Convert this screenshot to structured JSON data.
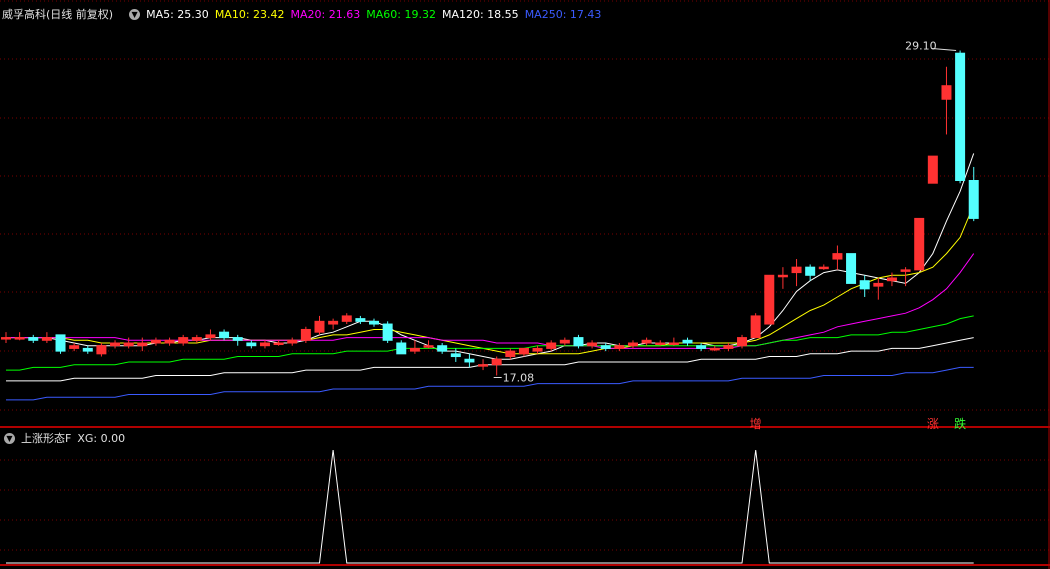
{
  "main_header": {
    "stock_name": "威孚高科",
    "period": "(日线 前复权)",
    "ma": [
      {
        "label": "MA5: 25.30",
        "color": "#ffffff"
      },
      {
        "label": "MA10: 23.42",
        "color": "#ffff00"
      },
      {
        "label": "MA20: 21.63",
        "color": "#ff00ff"
      },
      {
        "label": "MA60: 19.32",
        "color": "#00ff00"
      },
      {
        "label": "MA120: 18.55",
        "color": "#ffffff"
      },
      {
        "label": "MA250: 17.43",
        "color": "#3b5bff"
      }
    ]
  },
  "annotations": {
    "high": "29.10",
    "low": "17.08"
  },
  "signals": {
    "zeng": "增",
    "zhang": "涨",
    "die": "跌"
  },
  "sub_header": {
    "indicator": "上涨形态F",
    "xg": "XG: 0.00"
  },
  "colors": {
    "up": "#ff3232",
    "down": "#54ffff",
    "grid": "#7a0000",
    "border": "#b00000"
  },
  "chart_data": {
    "type": "candlestick",
    "price_range": [
      15.9,
      30.3
    ],
    "candles": [
      [
        18.5,
        18.7,
        18.3,
        18.5
      ],
      [
        18.5,
        18.7,
        18.4,
        18.5
      ],
      [
        18.5,
        18.6,
        18.3,
        18.4
      ],
      [
        18.4,
        18.7,
        18.3,
        18.5
      ],
      [
        18.6,
        18.6,
        17.9,
        18.0
      ],
      [
        18.1,
        18.3,
        18.0,
        18.2
      ],
      [
        18.1,
        18.2,
        17.9,
        18.0
      ],
      [
        17.9,
        18.3,
        17.8,
        18.2
      ],
      [
        18.2,
        18.4,
        18.1,
        18.3
      ],
      [
        18.2,
        18.5,
        18.1,
        18.3
      ],
      [
        18.2,
        18.5,
        18.0,
        18.3
      ],
      [
        18.3,
        18.5,
        18.2,
        18.4
      ],
      [
        18.3,
        18.5,
        18.2,
        18.4
      ],
      [
        18.3,
        18.6,
        18.2,
        18.5
      ],
      [
        18.4,
        18.6,
        18.3,
        18.5
      ],
      [
        18.5,
        18.8,
        18.4,
        18.6
      ],
      [
        18.7,
        18.8,
        18.4,
        18.5
      ],
      [
        18.5,
        18.6,
        18.2,
        18.4
      ],
      [
        18.3,
        18.4,
        18.1,
        18.2
      ],
      [
        18.2,
        18.4,
        18.1,
        18.3
      ],
      [
        18.3,
        18.4,
        18.2,
        18.3
      ],
      [
        18.3,
        18.5,
        18.2,
        18.4
      ],
      [
        18.4,
        18.9,
        18.3,
        18.8
      ],
      [
        18.7,
        19.3,
        18.6,
        19.1
      ],
      [
        19.0,
        19.2,
        18.8,
        19.1
      ],
      [
        19.1,
        19.4,
        19.0,
        19.3
      ],
      [
        19.2,
        19.3,
        19.0,
        19.1
      ],
      [
        19.1,
        19.2,
        18.9,
        19.0
      ],
      [
        19.0,
        19.1,
        18.3,
        18.4
      ],
      [
        18.3,
        18.4,
        17.9,
        17.9
      ],
      [
        18.0,
        18.4,
        17.9,
        18.1
      ],
      [
        18.2,
        18.4,
        18.1,
        18.2
      ],
      [
        18.2,
        18.3,
        17.9,
        18.0
      ],
      [
        17.9,
        18.1,
        17.6,
        17.8
      ],
      [
        17.7,
        17.9,
        17.4,
        17.6
      ],
      [
        17.5,
        17.7,
        17.3,
        17.5
      ],
      [
        17.5,
        17.8,
        17.1,
        17.7
      ],
      [
        17.8,
        18.1,
        17.7,
        18.0
      ],
      [
        17.9,
        18.1,
        17.8,
        18.1
      ],
      [
        18.0,
        18.2,
        17.9,
        18.1
      ],
      [
        18.1,
        18.4,
        18.0,
        18.3
      ],
      [
        18.3,
        18.5,
        18.2,
        18.4
      ],
      [
        18.5,
        18.6,
        18.1,
        18.2
      ],
      [
        18.2,
        18.4,
        18.1,
        18.3
      ],
      [
        18.2,
        18.3,
        18.0,
        18.1
      ],
      [
        18.1,
        18.3,
        18.0,
        18.2
      ],
      [
        18.2,
        18.4,
        18.1,
        18.3
      ],
      [
        18.3,
        18.5,
        18.2,
        18.4
      ],
      [
        18.3,
        18.4,
        18.2,
        18.3
      ],
      [
        18.3,
        18.5,
        18.2,
        18.3
      ],
      [
        18.4,
        18.5,
        18.2,
        18.3
      ],
      [
        18.2,
        18.3,
        18.0,
        18.1
      ],
      [
        18.1,
        18.2,
        18.0,
        18.1
      ],
      [
        18.1,
        18.3,
        18.0,
        18.2
      ],
      [
        18.2,
        18.6,
        18.1,
        18.5
      ],
      [
        18.5,
        19.4,
        18.5,
        19.3
      ],
      [
        19.0,
        20.8,
        19.0,
        20.8
      ],
      [
        20.8,
        21.1,
        20.3,
        20.8
      ],
      [
        20.9,
        21.4,
        20.4,
        21.1
      ],
      [
        21.1,
        21.2,
        20.6,
        20.8
      ],
      [
        21.1,
        21.2,
        21.0,
        21.1
      ],
      [
        21.4,
        21.9,
        21.0,
        21.6
      ],
      [
        21.6,
        21.6,
        20.5,
        20.5
      ],
      [
        20.6,
        20.8,
        20.0,
        20.3
      ],
      [
        20.4,
        20.7,
        19.9,
        20.5
      ],
      [
        20.6,
        20.9,
        20.4,
        20.7
      ],
      [
        21.0,
        21.1,
        20.4,
        21.0
      ],
      [
        21.0,
        22.9,
        21.0,
        22.9
      ],
      [
        24.2,
        25.2,
        24.2,
        25.2
      ],
      [
        27.3,
        28.5,
        26.0,
        27.8
      ],
      [
        29.0,
        29.1,
        24.2,
        24.3
      ],
      [
        24.3,
        24.8,
        22.8,
        22.9
      ]
    ],
    "ma_series": [
      {
        "name": "MA5",
        "color": "#ffffff",
        "values": [
          18.5,
          18.5,
          18.5,
          18.5,
          18.4,
          18.3,
          18.2,
          18.2,
          18.2,
          18.2,
          18.2,
          18.3,
          18.3,
          18.4,
          18.4,
          18.5,
          18.5,
          18.5,
          18.4,
          18.4,
          18.3,
          18.3,
          18.4,
          18.6,
          18.7,
          18.9,
          19.1,
          19.1,
          18.9,
          18.6,
          18.4,
          18.2,
          18.0,
          18.0,
          17.9,
          17.8,
          17.7,
          17.7,
          17.8,
          17.9,
          18.0,
          18.2,
          18.2,
          18.3,
          18.3,
          18.2,
          18.2,
          18.3,
          18.3,
          18.3,
          18.3,
          18.3,
          18.2,
          18.2,
          18.3,
          18.5,
          18.9,
          19.5,
          20.2,
          20.6,
          20.9,
          21.0,
          20.9,
          20.8,
          20.7,
          20.6,
          20.5,
          20.9,
          21.6,
          22.8,
          23.9,
          25.3
        ]
      },
      {
        "name": "MA10",
        "color": "#ffff00",
        "values": [
          18.5,
          18.5,
          18.5,
          18.5,
          18.5,
          18.4,
          18.4,
          18.3,
          18.3,
          18.3,
          18.3,
          18.3,
          18.3,
          18.3,
          18.3,
          18.4,
          18.4,
          18.4,
          18.4,
          18.4,
          18.4,
          18.4,
          18.4,
          18.5,
          18.6,
          18.6,
          18.7,
          18.8,
          18.8,
          18.7,
          18.6,
          18.5,
          18.4,
          18.3,
          18.2,
          18.1,
          18.0,
          17.9,
          17.9,
          17.9,
          17.9,
          17.9,
          17.9,
          18.0,
          18.1,
          18.1,
          18.2,
          18.2,
          18.2,
          18.3,
          18.3,
          18.3,
          18.3,
          18.3,
          18.3,
          18.4,
          18.6,
          18.9,
          19.2,
          19.5,
          19.7,
          20.0,
          20.3,
          20.5,
          20.7,
          20.8,
          20.8,
          20.9,
          21.1,
          21.6,
          22.2,
          23.4
        ]
      },
      {
        "name": "MA20",
        "color": "#ff00ff",
        "values": [
          18.5,
          18.5,
          18.5,
          18.5,
          18.5,
          18.5,
          18.5,
          18.5,
          18.5,
          18.4,
          18.4,
          18.4,
          18.4,
          18.4,
          18.4,
          18.4,
          18.4,
          18.4,
          18.4,
          18.4,
          18.4,
          18.4,
          18.4,
          18.4,
          18.4,
          18.5,
          18.5,
          18.5,
          18.5,
          18.5,
          18.5,
          18.5,
          18.4,
          18.4,
          18.4,
          18.4,
          18.3,
          18.3,
          18.3,
          18.3,
          18.2,
          18.2,
          18.2,
          18.2,
          18.1,
          18.1,
          18.1,
          18.1,
          18.1,
          18.1,
          18.1,
          18.1,
          18.1,
          18.1,
          18.2,
          18.2,
          18.3,
          18.4,
          18.5,
          18.6,
          18.7,
          18.9,
          19.0,
          19.1,
          19.2,
          19.3,
          19.4,
          19.6,
          19.9,
          20.3,
          20.9,
          21.6
        ]
      },
      {
        "name": "MA60",
        "color": "#00ff00",
        "values": [
          17.3,
          17.3,
          17.4,
          17.4,
          17.4,
          17.5,
          17.5,
          17.5,
          17.5,
          17.6,
          17.6,
          17.6,
          17.6,
          17.7,
          17.7,
          17.7,
          17.7,
          17.8,
          17.8,
          17.8,
          17.8,
          17.9,
          17.9,
          17.9,
          17.9,
          18.0,
          18.0,
          18.0,
          18.0,
          18.1,
          18.1,
          18.1,
          18.1,
          18.1,
          18.1,
          18.1,
          18.1,
          18.1,
          18.1,
          18.2,
          18.2,
          18.2,
          18.2,
          18.2,
          18.2,
          18.2,
          18.2,
          18.2,
          18.2,
          18.2,
          18.2,
          18.2,
          18.2,
          18.2,
          18.2,
          18.2,
          18.3,
          18.4,
          18.4,
          18.5,
          18.5,
          18.5,
          18.6,
          18.6,
          18.6,
          18.7,
          18.7,
          18.8,
          18.9,
          19.0,
          19.2,
          19.3
        ]
      },
      {
        "name": "MA120",
        "color": "#ffffff",
        "values": [
          16.9,
          16.9,
          16.9,
          16.9,
          16.9,
          17.0,
          17.0,
          17.0,
          17.0,
          17.0,
          17.0,
          17.1,
          17.1,
          17.1,
          17.1,
          17.1,
          17.2,
          17.2,
          17.2,
          17.2,
          17.2,
          17.2,
          17.3,
          17.3,
          17.3,
          17.3,
          17.3,
          17.4,
          17.4,
          17.4,
          17.4,
          17.4,
          17.4,
          17.4,
          17.4,
          17.5,
          17.5,
          17.5,
          17.5,
          17.5,
          17.5,
          17.5,
          17.6,
          17.6,
          17.6,
          17.6,
          17.6,
          17.6,
          17.6,
          17.6,
          17.6,
          17.7,
          17.7,
          17.7,
          17.7,
          17.7,
          17.8,
          17.8,
          17.8,
          17.9,
          17.9,
          17.9,
          18.0,
          18.0,
          18.0,
          18.1,
          18.1,
          18.1,
          18.2,
          18.3,
          18.4,
          18.5
        ]
      },
      {
        "name": "MA250",
        "color": "#3b5bff",
        "values": [
          16.2,
          16.2,
          16.2,
          16.3,
          16.3,
          16.3,
          16.3,
          16.3,
          16.3,
          16.4,
          16.4,
          16.4,
          16.4,
          16.4,
          16.4,
          16.4,
          16.5,
          16.5,
          16.5,
          16.5,
          16.5,
          16.5,
          16.5,
          16.5,
          16.6,
          16.6,
          16.6,
          16.6,
          16.6,
          16.6,
          16.6,
          16.7,
          16.7,
          16.7,
          16.7,
          16.7,
          16.7,
          16.7,
          16.7,
          16.8,
          16.8,
          16.8,
          16.8,
          16.8,
          16.8,
          16.8,
          16.9,
          16.9,
          16.9,
          16.9,
          16.9,
          16.9,
          16.9,
          16.9,
          17.0,
          17.0,
          17.0,
          17.0,
          17.0,
          17.0,
          17.1,
          17.1,
          17.1,
          17.1,
          17.1,
          17.1,
          17.2,
          17.2,
          17.2,
          17.3,
          17.4,
          17.4
        ]
      }
    ],
    "signal_days": {
      "zeng": 55,
      "zhang": 68,
      "die": 70
    },
    "xg_series": {
      "range": [
        0,
        1
      ],
      "ones": [
        24,
        55
      ]
    }
  }
}
